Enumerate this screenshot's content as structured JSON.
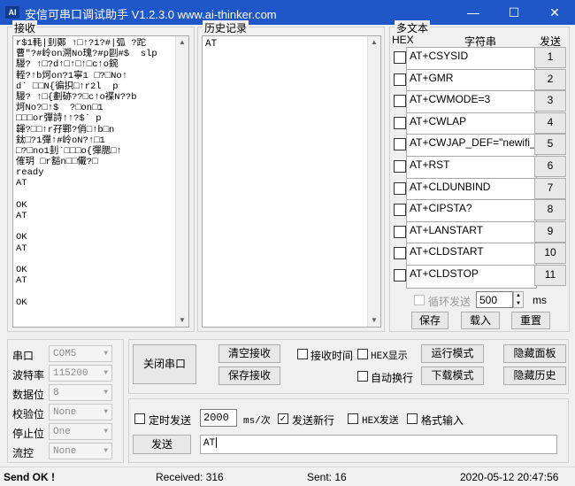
{
  "window": {
    "title": "安信可串口调试助手 V1.2.3.0    www.ai-thinker.com",
    "logo": "AI",
    "minimize_icon": "—",
    "maximize_icon": "☐",
    "close_icon": "✕"
  },
  "receive": {
    "label": "接收",
    "lines": [
      "r$1軞|刲鄭 ↑□↑?1?#|弧 ?跎",
      "曹\"?#岭on溯No瑰?#p剾#$  slp",
      "騴? ↑□?d↑□↑□↑□c↑o鋺",
      "輊?↑b炣on?1寧1 □?□No↑",
      "d` □□N{徧抧□↑r2l  p",
      "騴? ↑□{劃硛??□c↑o褋N??b",
      "炣No?□↑$  ?□on□1",
      "□□□or彈詩↑↑?$` p",
      "韗?□□↑r孖鄲?俏□↑b□n",
      "鈦□?1彈↑#岭oN?↑□1",
      "□?□no1刲`□□□o{彈腮□↑",
      "傕玥 □r豁n□□儎?□",
      "ready",
      "AT",
      "",
      "OK",
      "AT",
      "",
      "OK",
      "AT",
      "",
      "OK",
      "AT",
      "",
      "OK"
    ]
  },
  "history": {
    "label": "历史记录",
    "items": [
      "AT"
    ]
  },
  "multitext": {
    "label": "多文本",
    "col_hex": "HEX",
    "col_string": "字符串",
    "col_send": "发送",
    "rows": [
      {
        "cmd": "AT+CSYSID",
        "num": "1"
      },
      {
        "cmd": "AT+GMR",
        "num": "2"
      },
      {
        "cmd": "AT+CWMODE=3",
        "num": "3"
      },
      {
        "cmd": "AT+CWLAP",
        "num": "4"
      },
      {
        "cmd": "AT+CWJAP_DEF=\"newifi_",
        "num": "5"
      },
      {
        "cmd": "AT+RST",
        "num": "6"
      },
      {
        "cmd": "AT+CLDUNBIND",
        "num": "7"
      },
      {
        "cmd": "AT+CIPSTA?",
        "num": "8"
      },
      {
        "cmd": "AT+LANSTART",
        "num": "9"
      },
      {
        "cmd": "AT+CLDSTART",
        "num": "10"
      },
      {
        "cmd": "AT+CLDSTOP",
        "num": "11"
      }
    ],
    "loop_label": "循环发送",
    "loop_interval": "500",
    "loop_unit": "ms",
    "save_label": "保存",
    "load_label": "载入",
    "reset_label": "重置"
  },
  "port": {
    "port_label": "串口",
    "port_value": "COM5",
    "baud_label": "波特率",
    "baud_value": "115200",
    "data_label": "数据位",
    "data_value": "8",
    "parity_label": "校验位",
    "parity_value": "None",
    "stop_label": "停止位",
    "stop_value": "One",
    "flow_label": "流控",
    "flow_value": "None"
  },
  "controls": {
    "close_port": "关闭串口",
    "clear_receive": "清空接收",
    "save_receive": "保存接收",
    "receive_time": "接收时间",
    "hex_display": "HEX显示",
    "auto_wrap": "自动换行",
    "run_mode": "运行模式",
    "download_mode": "下载模式",
    "hide_panel": "隐藏面板",
    "hide_history": "隐藏历史"
  },
  "send": {
    "timed_send": "定时发送",
    "interval": "2000",
    "interval_unit": "ms/次",
    "new_line": "发送新行",
    "hex_send": "HEX发送",
    "format_input": "格式输入",
    "send_label": "发送",
    "send_text": "AT"
  },
  "status": {
    "message": "Send OK !",
    "received": "Received: 316",
    "sent": "Sent: 16",
    "datetime": "2020-05-12 20:47:56"
  }
}
